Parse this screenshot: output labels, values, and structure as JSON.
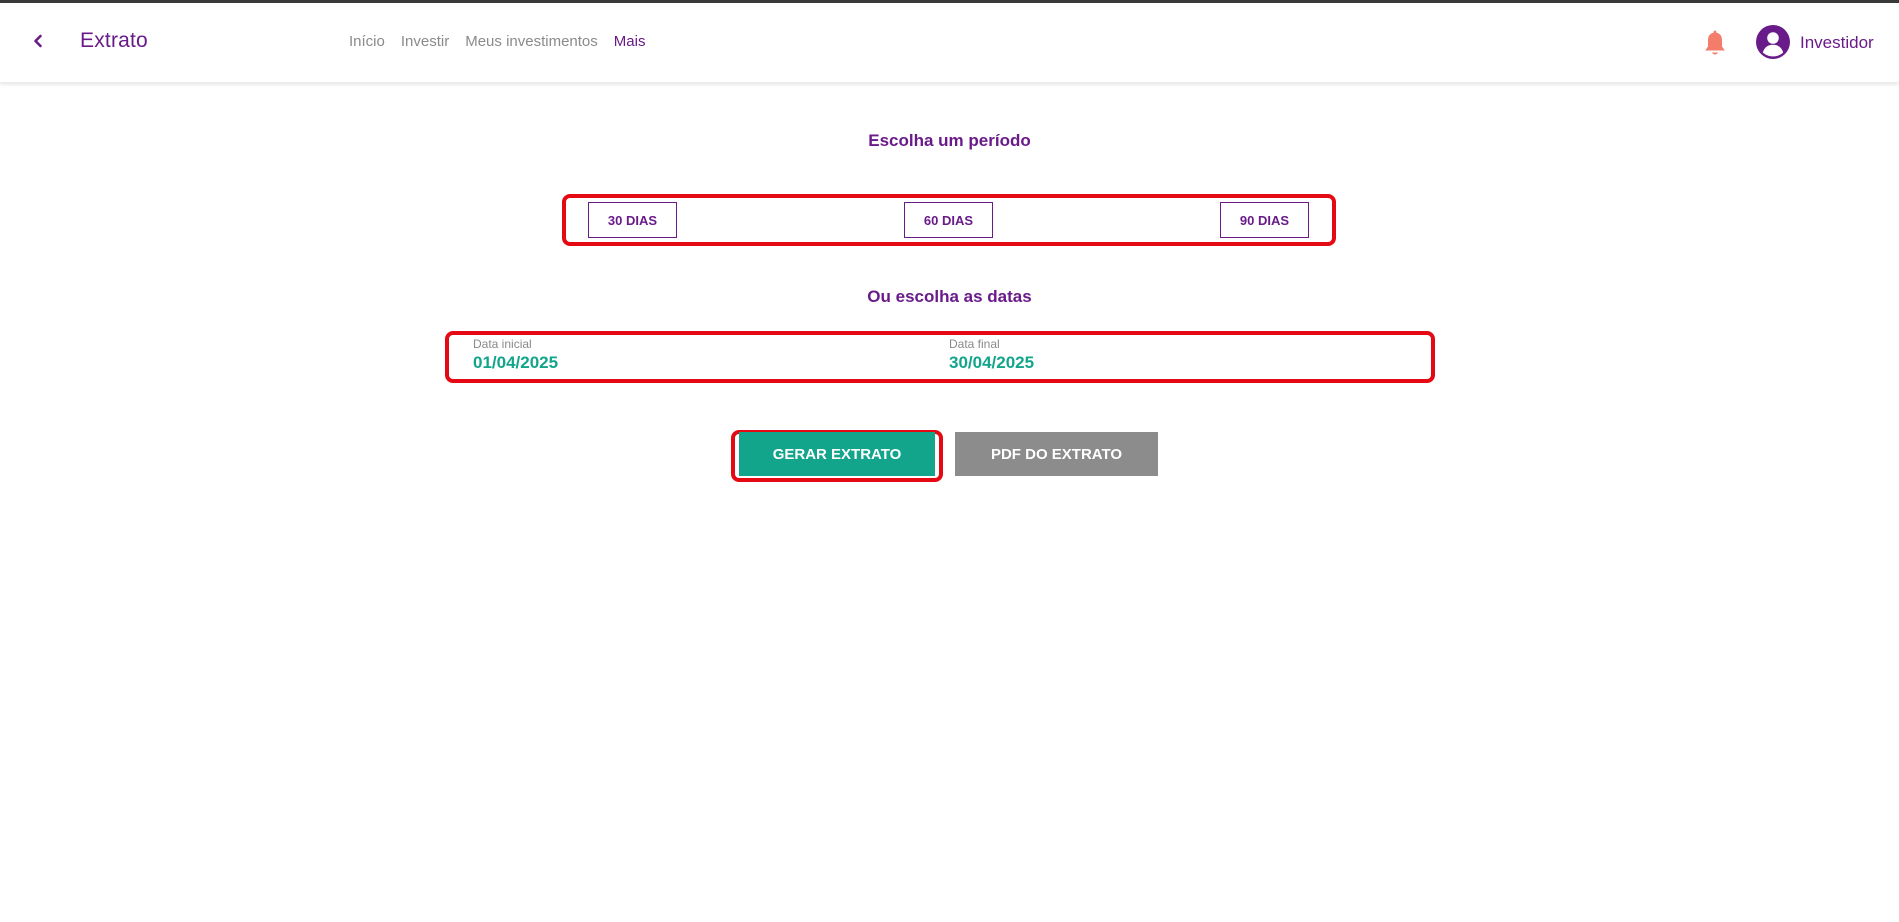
{
  "header": {
    "title": "Extrato",
    "nav": [
      {
        "label": "Início",
        "active": false
      },
      {
        "label": "Investir",
        "active": false
      },
      {
        "label": "Meus investimentos",
        "active": false
      },
      {
        "label": "Mais",
        "active": true
      }
    ],
    "user_name": "Investidor",
    "icons": {
      "back": "chevron-left-icon",
      "notifications": "bell-icon",
      "avatar": "user-avatar-icon"
    }
  },
  "main": {
    "period_title": "Escolha um período",
    "period_buttons": [
      "30 DIAS",
      "60 DIAS",
      "90 DIAS"
    ],
    "dates_title": "Ou escolha as datas",
    "start_date": {
      "label": "Data inicial",
      "value": "01/04/2025"
    },
    "end_date": {
      "label": "Data final",
      "value": "30/04/2025"
    },
    "generate_button": "GERAR EXTRATO",
    "pdf_button": "PDF DO EXTRATO"
  },
  "colors": {
    "brand_purple": "#6a1b8a",
    "accent_teal": "#12a58c",
    "disabled_gray": "#8c8c8c",
    "bell_coral": "#f47c6a",
    "highlight_red": "#e50914"
  }
}
